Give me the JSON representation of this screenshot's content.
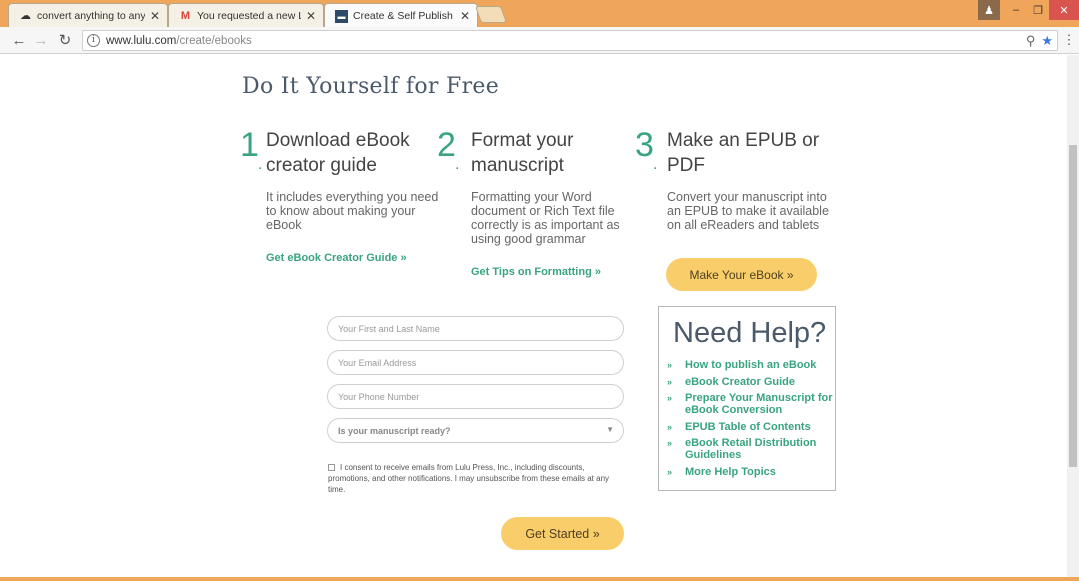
{
  "browser": {
    "tabs": [
      {
        "label": "convert anything to any",
        "icon": "cloud-icon"
      },
      {
        "label": "You requested a new Lul",
        "icon": "gmail-icon"
      },
      {
        "label": "Create & Self Publish Yo",
        "icon": "lulu-icon",
        "active": true
      }
    ],
    "close_glyph": "✕",
    "url_host": "www.lulu.com",
    "url_path": "/create/ebooks",
    "colors": {
      "tabbar": "#f0a65a",
      "window_close": "#d9534f"
    }
  },
  "page": {
    "title": "Do It Yourself for Free",
    "steps": [
      {
        "number": "1",
        "heading": "Download eBook creator guide",
        "description": "It includes everything you need to know about making your eBook",
        "link": "Get eBook Creator Guide »"
      },
      {
        "number": "2",
        "heading": "Format your manuscript",
        "description": "Formatting your Word document or Rich Text file correctly is as important as using good grammar",
        "link": "Get Tips on Formatting »"
      },
      {
        "number": "3",
        "heading": "Make an EPUB or PDF",
        "description": "Convert your manuscript into an EPUB to make it available on all eReaders and tablets",
        "button": "Make Your eBook »"
      }
    ],
    "form": {
      "name_placeholder": "Your First and Last Name",
      "email_placeholder": "Your Email Address",
      "phone_placeholder": "Your Phone Number",
      "manuscript_select": "Is your manuscript ready?",
      "consent_text": "I consent to receive emails from Lulu Press, Inc., including discounts, promotions, and other notifications. I may unsubscribe from these emails at any time.",
      "submit": "Get Started »"
    },
    "help": {
      "title": "Need Help?",
      "bullet": "»",
      "links": [
        "How to publish an eBook",
        "eBook Creator Guide",
        "Prepare Your Manuscript for eBook Conversion",
        "EPUB Table of Contents",
        "eBook Retail Distribution Guidelines",
        "More Help Topics"
      ]
    },
    "colors": {
      "accent_green": "#3aa47f",
      "button_yellow": "#f9ce6a",
      "title_slate": "#4a5a6a"
    }
  }
}
